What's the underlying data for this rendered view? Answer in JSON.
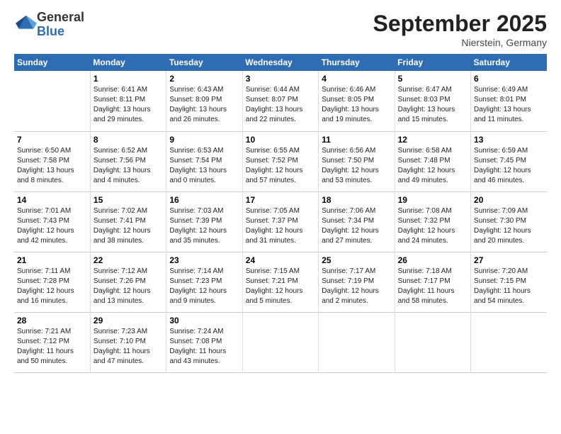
{
  "header": {
    "logo_general": "General",
    "logo_blue": "Blue",
    "month_title": "September 2025",
    "location": "Nierstein, Germany"
  },
  "days_of_week": [
    "Sunday",
    "Monday",
    "Tuesday",
    "Wednesday",
    "Thursday",
    "Friday",
    "Saturday"
  ],
  "weeks": [
    [
      {
        "num": "",
        "info": ""
      },
      {
        "num": "1",
        "info": "Sunrise: 6:41 AM\nSunset: 8:11 PM\nDaylight: 13 hours\nand 29 minutes."
      },
      {
        "num": "2",
        "info": "Sunrise: 6:43 AM\nSunset: 8:09 PM\nDaylight: 13 hours\nand 26 minutes."
      },
      {
        "num": "3",
        "info": "Sunrise: 6:44 AM\nSunset: 8:07 PM\nDaylight: 13 hours\nand 22 minutes."
      },
      {
        "num": "4",
        "info": "Sunrise: 6:46 AM\nSunset: 8:05 PM\nDaylight: 13 hours\nand 19 minutes."
      },
      {
        "num": "5",
        "info": "Sunrise: 6:47 AM\nSunset: 8:03 PM\nDaylight: 13 hours\nand 15 minutes."
      },
      {
        "num": "6",
        "info": "Sunrise: 6:49 AM\nSunset: 8:01 PM\nDaylight: 13 hours\nand 11 minutes."
      }
    ],
    [
      {
        "num": "7",
        "info": "Sunrise: 6:50 AM\nSunset: 7:58 PM\nDaylight: 13 hours\nand 8 minutes."
      },
      {
        "num": "8",
        "info": "Sunrise: 6:52 AM\nSunset: 7:56 PM\nDaylight: 13 hours\nand 4 minutes."
      },
      {
        "num": "9",
        "info": "Sunrise: 6:53 AM\nSunset: 7:54 PM\nDaylight: 13 hours\nand 0 minutes."
      },
      {
        "num": "10",
        "info": "Sunrise: 6:55 AM\nSunset: 7:52 PM\nDaylight: 12 hours\nand 57 minutes."
      },
      {
        "num": "11",
        "info": "Sunrise: 6:56 AM\nSunset: 7:50 PM\nDaylight: 12 hours\nand 53 minutes."
      },
      {
        "num": "12",
        "info": "Sunrise: 6:58 AM\nSunset: 7:48 PM\nDaylight: 12 hours\nand 49 minutes."
      },
      {
        "num": "13",
        "info": "Sunrise: 6:59 AM\nSunset: 7:45 PM\nDaylight: 12 hours\nand 46 minutes."
      }
    ],
    [
      {
        "num": "14",
        "info": "Sunrise: 7:01 AM\nSunset: 7:43 PM\nDaylight: 12 hours\nand 42 minutes."
      },
      {
        "num": "15",
        "info": "Sunrise: 7:02 AM\nSunset: 7:41 PM\nDaylight: 12 hours\nand 38 minutes."
      },
      {
        "num": "16",
        "info": "Sunrise: 7:03 AM\nSunset: 7:39 PM\nDaylight: 12 hours\nand 35 minutes."
      },
      {
        "num": "17",
        "info": "Sunrise: 7:05 AM\nSunset: 7:37 PM\nDaylight: 12 hours\nand 31 minutes."
      },
      {
        "num": "18",
        "info": "Sunrise: 7:06 AM\nSunset: 7:34 PM\nDaylight: 12 hours\nand 27 minutes."
      },
      {
        "num": "19",
        "info": "Sunrise: 7:08 AM\nSunset: 7:32 PM\nDaylight: 12 hours\nand 24 minutes."
      },
      {
        "num": "20",
        "info": "Sunrise: 7:09 AM\nSunset: 7:30 PM\nDaylight: 12 hours\nand 20 minutes."
      }
    ],
    [
      {
        "num": "21",
        "info": "Sunrise: 7:11 AM\nSunset: 7:28 PM\nDaylight: 12 hours\nand 16 minutes."
      },
      {
        "num": "22",
        "info": "Sunrise: 7:12 AM\nSunset: 7:26 PM\nDaylight: 12 hours\nand 13 minutes."
      },
      {
        "num": "23",
        "info": "Sunrise: 7:14 AM\nSunset: 7:23 PM\nDaylight: 12 hours\nand 9 minutes."
      },
      {
        "num": "24",
        "info": "Sunrise: 7:15 AM\nSunset: 7:21 PM\nDaylight: 12 hours\nand 5 minutes."
      },
      {
        "num": "25",
        "info": "Sunrise: 7:17 AM\nSunset: 7:19 PM\nDaylight: 12 hours\nand 2 minutes."
      },
      {
        "num": "26",
        "info": "Sunrise: 7:18 AM\nSunset: 7:17 PM\nDaylight: 11 hours\nand 58 minutes."
      },
      {
        "num": "27",
        "info": "Sunrise: 7:20 AM\nSunset: 7:15 PM\nDaylight: 11 hours\nand 54 minutes."
      }
    ],
    [
      {
        "num": "28",
        "info": "Sunrise: 7:21 AM\nSunset: 7:12 PM\nDaylight: 11 hours\nand 50 minutes."
      },
      {
        "num": "29",
        "info": "Sunrise: 7:23 AM\nSunset: 7:10 PM\nDaylight: 11 hours\nand 47 minutes."
      },
      {
        "num": "30",
        "info": "Sunrise: 7:24 AM\nSunset: 7:08 PM\nDaylight: 11 hours\nand 43 minutes."
      },
      {
        "num": "",
        "info": ""
      },
      {
        "num": "",
        "info": ""
      },
      {
        "num": "",
        "info": ""
      },
      {
        "num": "",
        "info": ""
      }
    ]
  ]
}
